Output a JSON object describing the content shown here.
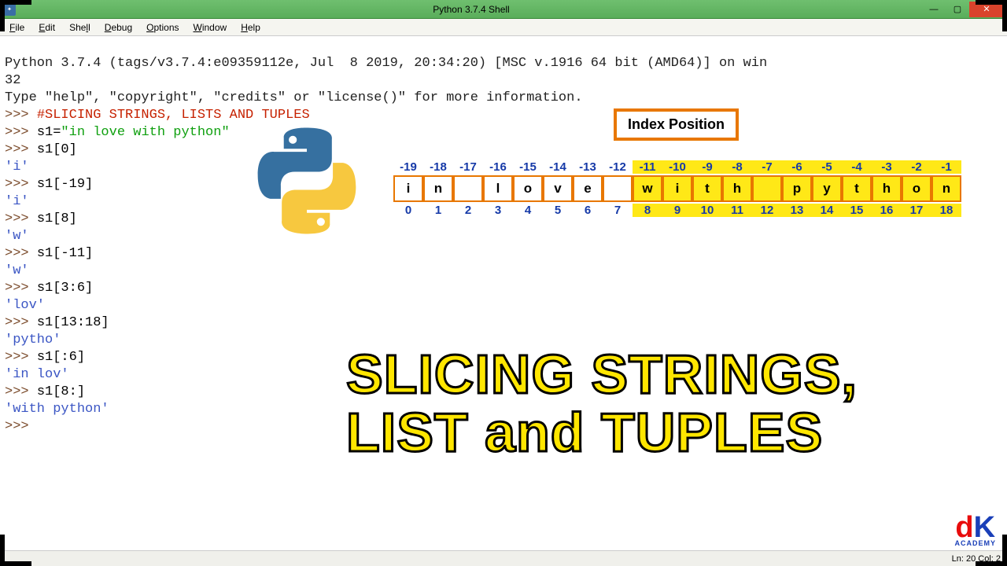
{
  "window": {
    "title": "Python 3.7.4 Shell",
    "min": "—",
    "max": "▢",
    "close": "✕"
  },
  "menu": [
    "File",
    "Edit",
    "Shell",
    "Debug",
    "Options",
    "Window",
    "Help"
  ],
  "editor": {
    "banner1": "Python 3.7.4 (tags/v3.7.4:e09359112e, Jul  8 2019, 20:34:20) [MSC v.1916 64 bit (AMD64)] on win",
    "banner2": "32",
    "banner3": "Type \"help\", \"copyright\", \"credits\" or \"license()\" for more information.",
    "prompt": ">>> ",
    "comment": "#SLICING STRINGS, LISTS AND TUPLES",
    "assign_code": "s1=",
    "assign_str": "\"in love with python\"",
    "lines": [
      {
        "in": "s1[0]",
        "out": "'i'"
      },
      {
        "in": "s1[-19]",
        "out": "'i'"
      },
      {
        "in": "s1[8]",
        "out": "'w'"
      },
      {
        "in": "s1[-11]",
        "out": "'w'"
      },
      {
        "in": "s1[3:6]",
        "out": "'lov'"
      },
      {
        "in": "s1[13:18]",
        "out": "'pytho'"
      },
      {
        "in": "s1[:6]",
        "out": "'in lov'"
      },
      {
        "in": "s1[8:]",
        "out": "'with python'"
      }
    ]
  },
  "statusbar": "Ln: 20  Col: 2",
  "overlay": {
    "index_title": "Index Position",
    "chars": [
      "i",
      "n",
      " ",
      "l",
      "o",
      "v",
      "e",
      " ",
      "w",
      "i",
      "t",
      "h",
      " ",
      "p",
      "y",
      "t",
      "h",
      "o",
      "n"
    ],
    "neg": [
      "-19",
      "-18",
      "-17",
      "-16",
      "-15",
      "-14",
      "-13",
      "-12",
      "-11",
      "-10",
      "-9",
      "-8",
      "-7",
      "-6",
      "-5",
      "-4",
      "-3",
      "-2",
      "-1"
    ],
    "pos": [
      "0",
      "1",
      "2",
      "3",
      "4",
      "5",
      "6",
      "7",
      "8",
      "9",
      "10",
      "11",
      "12",
      "13",
      "14",
      "15",
      "16",
      "17",
      "18"
    ],
    "big_title_1": "SLICING STRINGS,",
    "big_title_2": "LIST and TUPLES",
    "academy": "ACADEMY"
  }
}
